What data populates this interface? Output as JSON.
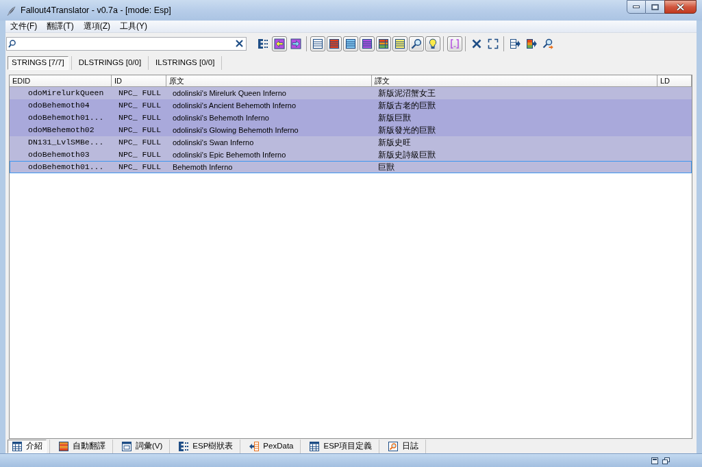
{
  "window": {
    "title": "Fallout4Translator - v0.7a - [mode: Esp]"
  },
  "menu": [
    "文件(F)",
    "翻譯(T)",
    "選項(Z)",
    "工具(Y)"
  ],
  "toolbar": [
    [
      {
        "pressed": false
      },
      {
        "pressed": true
      },
      {
        "pressed": false
      }
    ],
    [
      {
        "pressed": true
      },
      {
        "pressed": true
      },
      {
        "pressed": true
      },
      {
        "pressed": true
      },
      {
        "pressed": true
      },
      {
        "pressed": true
      },
      {
        "pressed": true
      },
      {
        "pressed": true
      }
    ],
    [
      {
        "pressed": true
      }
    ],
    [
      {
        "pressed": false
      },
      {
        "pressed": false
      }
    ],
    [
      {
        "pressed": false
      },
      {
        "pressed": false
      },
      {
        "pressed": false
      }
    ]
  ],
  "tabs": [
    {
      "label": "STRINGS [7/7]",
      "selected": true
    },
    {
      "label": "DLSTRINGS [0/0]",
      "selected": false
    },
    {
      "label": "ILSTRINGS [0/0]",
      "selected": false
    }
  ],
  "table": {
    "columns": [
      "EDID",
      "ID",
      "原文",
      "譯文",
      "LD"
    ],
    "rows": [
      {
        "cells": [
          "odoMirelurkQueen",
          "NPC_ FULL",
          "odolinski's Mirelurk Queen Inferno",
          "新版泥沼蟹女王"
        ],
        "selected": false,
        "focused": false
      },
      {
        "cells": [
          "odoBehemoth04",
          "NPC_ FULL",
          "odolinski's Ancient Behemoth Inferno",
          "新版古老的巨獸"
        ],
        "selected": true,
        "focused": false
      },
      {
        "cells": [
          "odoBehemoth01...",
          "NPC_ FULL",
          "odolinski's Behemoth Inferno",
          "新版巨獸"
        ],
        "selected": true,
        "focused": false
      },
      {
        "cells": [
          "odoMBehemoth02",
          "NPC_ FULL",
          "odolinski's Glowing Behemoth Inferno",
          "新版發光的巨獸"
        ],
        "selected": true,
        "focused": false
      },
      {
        "cells": [
          "DN131_LvlSMBe...",
          "NPC_ FULL",
          "odolinski's Swan Inferno",
          "新版史旺"
        ],
        "selected": false,
        "focused": false
      },
      {
        "cells": [
          "odoBehemoth03",
          "NPC_ FULL",
          "odolinski's Epic Behemoth Inferno",
          "新版史詩級巨獸"
        ],
        "selected": false,
        "focused": false
      },
      {
        "cells": [
          "odoBehemoth01...",
          "NPC_ FULL",
          "Behemoth Inferno",
          "巨獸"
        ],
        "selected": false,
        "focused": true
      }
    ]
  },
  "bottom_tabs": [
    {
      "label": "介紹",
      "selected": true
    },
    {
      "label": "自動翻譯",
      "selected": false
    },
    {
      "label": "詞彙(V)",
      "selected": false
    },
    {
      "label": "ESP樹狀表",
      "selected": false
    },
    {
      "label": "PexData",
      "selected": false
    },
    {
      "label": "ESP項目定義",
      "selected": false
    },
    {
      "label": "日誌",
      "selected": false
    }
  ]
}
